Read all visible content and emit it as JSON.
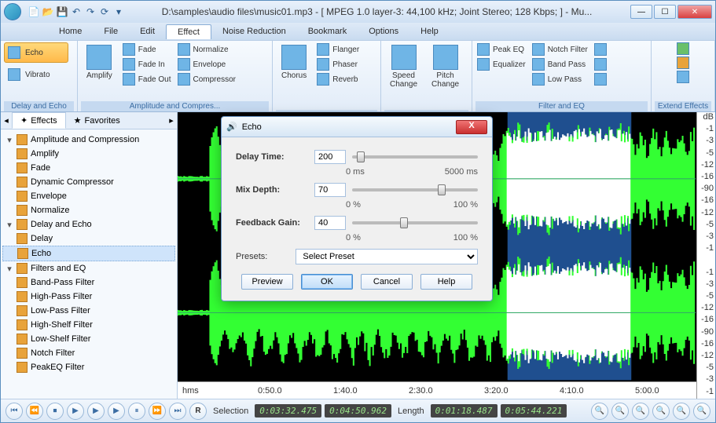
{
  "title": "D:\\samples\\audio files\\music01.mp3 - [ MPEG 1.0 layer-3: 44,100 kHz; Joint Stereo; 128 Kbps;  ] - Mu...",
  "menus": [
    "Home",
    "File",
    "Edit",
    "Effect",
    "Noise Reduction",
    "Bookmark",
    "Options",
    "Help"
  ],
  "active_menu": 3,
  "ribbon": {
    "g1": {
      "title": "Delay and Echo",
      "echo": "Echo",
      "vibrato": "Vibrato"
    },
    "g2": {
      "title": "Amplitude and Compres...",
      "amplify": "Amplify",
      "fade": "Fade",
      "fadein": "Fade In",
      "fadeout": "Fade Out",
      "normalize": "Normalize",
      "envelope": "Envelope",
      "compressor": "Compressor"
    },
    "g3": {
      "title": "",
      "chorus": "Chorus",
      "flanger": "Flanger",
      "phaser": "Phaser",
      "reverb": "Reverb"
    },
    "g4": {
      "title": "",
      "speed": "Speed\nChange",
      "pitch": "Pitch\nChange"
    },
    "g5": {
      "title": "Filter and EQ",
      "peakeq": "Peak EQ",
      "equalizer": "Equalizer",
      "notch": "Notch Filter",
      "bandpass": "Band Pass",
      "lowpass": "Low Pass"
    },
    "g6": {
      "title": "Extend Effects"
    }
  },
  "tabs": {
    "effects": "Effects",
    "favorites": "Favorites"
  },
  "tree": [
    {
      "l": 0,
      "exp": true,
      "label": "Amplitude and Compression"
    },
    {
      "l": 1,
      "label": "Amplify"
    },
    {
      "l": 1,
      "label": "Fade"
    },
    {
      "l": 1,
      "label": "Dynamic Compressor"
    },
    {
      "l": 1,
      "label": "Envelope"
    },
    {
      "l": 1,
      "label": "Normalize"
    },
    {
      "l": 0,
      "exp": true,
      "label": "Delay and Echo"
    },
    {
      "l": 1,
      "label": "Delay"
    },
    {
      "l": 1,
      "label": "Echo",
      "sel": true
    },
    {
      "l": 0,
      "exp": true,
      "label": "Filters and EQ"
    },
    {
      "l": 1,
      "label": "Band-Pass Filter"
    },
    {
      "l": 1,
      "label": "High-Pass Filter"
    },
    {
      "l": 1,
      "label": "Low-Pass Filter"
    },
    {
      "l": 1,
      "label": "High-Shelf Filter"
    },
    {
      "l": 1,
      "label": "Low-Shelf Filter"
    },
    {
      "l": 1,
      "label": "Notch Filter"
    },
    {
      "l": 1,
      "label": "PeakEQ Filter"
    }
  ],
  "db_ticks": [
    "dB",
    "-1",
    "-3",
    "-5",
    "-12",
    "-16",
    "-90",
    "-16",
    "-12",
    "-5",
    "-3",
    "-1",
    "",
    "-1",
    "-3",
    "-5",
    "-12",
    "-16",
    "-90",
    "-16",
    "-12",
    "-5",
    "-3",
    "-1"
  ],
  "timeline": [
    "hms",
    "0:50.0",
    "1:40.0",
    "2:30.0",
    "3:20.0",
    "4:10.0",
    "5:00.0"
  ],
  "status": {
    "selection": "Selection",
    "sel_start": "0:03:32.475",
    "sel_end": "0:04:50.962",
    "length_lbl": "Length",
    "len": "0:01:18.487",
    "tot": "0:05:44.221",
    "r": "R"
  },
  "dialog": {
    "title": "Echo",
    "delay_lbl": "Delay Time:",
    "delay_val": "200",
    "delay_min": "0 ms",
    "delay_max": "5000 ms",
    "delay_thumb": 4,
    "mix_lbl": "Mix Depth:",
    "mix_val": "70",
    "mix_min": "0 %",
    "mix_max": "100 %",
    "mix_thumb": 70,
    "fb_lbl": "Feedback Gain:",
    "fb_val": "40",
    "fb_min": "0 %",
    "fb_max": "100 %",
    "fb_thumb": 40,
    "presets_lbl": "Presets:",
    "preset_sel": "Select Preset",
    "preview": "Preview",
    "ok": "OK",
    "cancel": "Cancel",
    "help": "Help"
  }
}
